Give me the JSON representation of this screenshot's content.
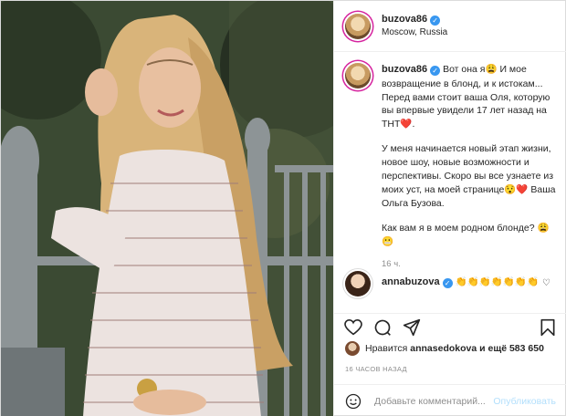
{
  "post": {
    "username": "buzova86",
    "location": "Moscow, Russia",
    "caption": {
      "p1": "Вот она я😩 И мое возвращение в блонд, и к истокам... Перед вами стоит ваша Оля, которую вы впервые увидели 17 лет назад на ТНТ❤️.",
      "p2": "У меня начинается новый этап жизни, новое шоу, новые возможности и перспективы. Скоро вы все узнаете из моих уст, на моей странице😯❤️ Ваша Ольга Бузова.",
      "p3": "Как вам я в моем родном блонде? 😩😬"
    },
    "caption_time": "16 ч.",
    "comment": {
      "username": "annabuzova",
      "text": "👏👏👏👏👏👏👏"
    },
    "likes": {
      "prefix": "Нравится",
      "liker": "annasedokova",
      "suffix": "и ещё 583 650"
    },
    "time_ago": "16 ЧАСОВ НАЗАД",
    "add_comment": {
      "placeholder": "Добавьте комментарий...",
      "post_label": "Опубликовать"
    },
    "colors": {
      "verified": "#3897f0",
      "post_button_disabled": "#b2dffc",
      "muted": "#8e8e8e"
    }
  }
}
